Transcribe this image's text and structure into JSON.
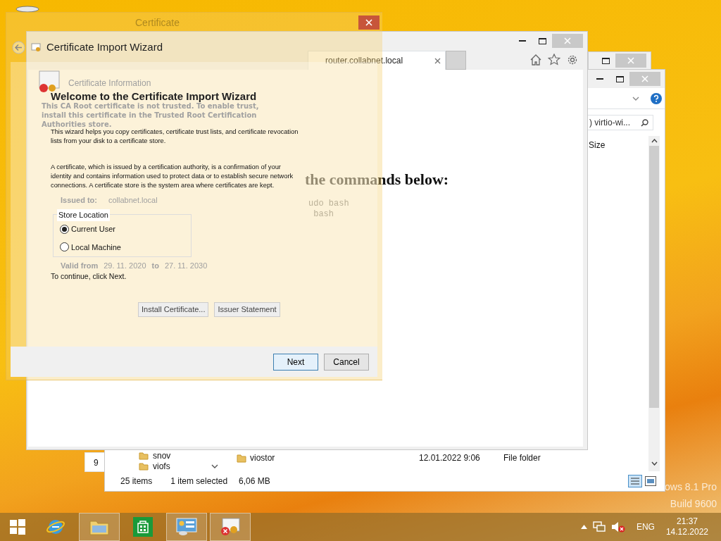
{
  "desktop": {
    "watermark": [
      "ows 8.1 Pro",
      "Build 9600"
    ]
  },
  "back_window": {
    "text": "9"
  },
  "explorer": {
    "search": ") virtio-wi...",
    "column": "Size",
    "nav_items": [
      "snov",
      "viofs"
    ],
    "file": {
      "name": "viostor",
      "date": "12.01.2022 9:06",
      "type": "File folder"
    },
    "status": [
      "25 items",
      "1 item selected",
      "6,06 MB"
    ]
  },
  "browser": {
    "tab": {
      "label": "router.collabnet.local"
    },
    "heading": "the commands below:",
    "code": [
      "udo bash",
      " bash"
    ]
  },
  "certificate_dialog": {
    "title": "Certificate",
    "section": "Certificate Information",
    "warning": "This CA Root certificate is not trusted. To enable trust, install this certificate in the Trusted Root Certification Authorities store.",
    "issued_to": {
      "label": "Issued to:",
      "value": "collabnet.local"
    },
    "valid": {
      "label": "Valid from",
      "from": "29. 11. 2020",
      "to_label": "to",
      "to": "27. 11. 2030"
    },
    "buttons": [
      "Install Certificate...",
      "Issuer Statement"
    ]
  },
  "wizard": {
    "title": "Certificate Import Wizard",
    "heading": "Welcome to the Certificate Import Wizard",
    "paragraphs": [
      "This wizard helps you copy certificates, certificate trust lists, and certificate revocation lists from your disk to a certificate store.",
      "A certificate, which is issued by a certification authority, is a confirmation of your identity and contains information used to protect data or to establish secure network connections. A certificate store is the system area where certificates are kept."
    ],
    "store_location": {
      "label": "Store Location",
      "options": [
        {
          "label": "Current User",
          "selected": true
        },
        {
          "label": "Local Machine",
          "selected": false
        }
      ]
    },
    "hint": "To continue, click Next.",
    "buttons": [
      {
        "label": "Next",
        "default": true
      },
      {
        "label": "Cancel",
        "default": false
      }
    ]
  },
  "taskbar": {
    "apps": [
      {
        "kind": "browser",
        "open": false
      },
      {
        "kind": "files",
        "open": true
      },
      {
        "kind": "store",
        "open": false
      },
      {
        "kind": "control",
        "open": true
      },
      {
        "kind": "certificate",
        "open": true
      }
    ],
    "tray": {
      "language": "ENG",
      "time": "21:37",
      "date": "14.12.2022"
    }
  }
}
